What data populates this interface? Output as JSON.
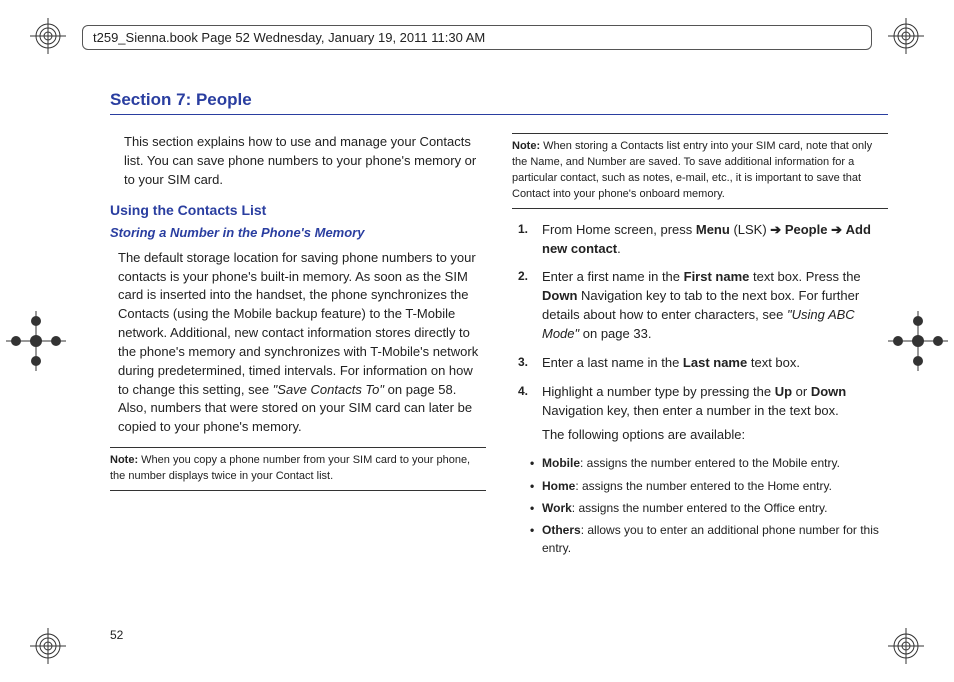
{
  "header": "t259_Sienna.book  Page 52  Wednesday, January 19, 2011  11:30 AM",
  "section_title": "Section 7: People",
  "page_num": "52",
  "left": {
    "intro": "This section explains how to use and manage your Contacts list. You can save phone numbers to your phone's memory or to your SIM card.",
    "h1": "Using the Contacts List",
    "h2": "Storing a Number in the Phone's Memory",
    "body": "The default storage location for saving phone numbers to your contacts is your phone's built-in memory. As soon as the SIM card is inserted into the handset, the phone synchronizes the Contacts (using the Mobile backup feature) to the T-Mobile network. Additional, new contact information stores directly to the phone's memory and synchronizes with T-Mobile's network during predetermined, timed intervals. For information on how to change this setting, see ",
    "body_ref": "\"Save Contacts To\"",
    "body_after": " on page 58. Also, numbers that were stored on your SIM card can later be copied to your phone's memory.",
    "note_lead": "Note:",
    "note": " When you copy a phone number from your SIM card to your phone, the number displays twice in your Contact list."
  },
  "right": {
    "note_lead": "Note:",
    "note": " When storing a Contacts list entry into your SIM card, note that only the Name, and Number are saved. To save additional information for a particular contact, such as notes, e-mail, etc., it is important to save that Contact into your phone's onboard memory.",
    "steps": [
      {
        "n": "1.",
        "pre": "From Home screen, press ",
        "b1": "Menu",
        "mid1": " (LSK) ",
        "arrow1": "➔",
        "sp1": " ",
        "b2": "People",
        "sp2": " ",
        "arrow2": "➔",
        "sp3": " ",
        "b3": "Add new contact",
        "post": "."
      },
      {
        "n": "2.",
        "pre": "Enter a first name in the ",
        "b1": "First name",
        "mid1": " text box. Press the ",
        "b2": "Down",
        "mid2": " Navigation key to tab to the next box. For further details about how to enter characters, see ",
        "i1": "\"Using ABC Mode\"",
        "post": " on page 33."
      },
      {
        "n": "3.",
        "pre": "Enter a last name in the ",
        "b1": "Last name",
        "post": " text box."
      },
      {
        "n": "4.",
        "pre": "Highlight a number type by pressing the ",
        "b1": "Up",
        "mid1": " or ",
        "b2": "Down",
        "post": " Navigation key, then enter a number in the text box.",
        "sub": "The following options are available:"
      }
    ],
    "bullets": [
      {
        "b": "Mobile",
        "t": ": assigns the number entered to the Mobile entry."
      },
      {
        "b": "Home",
        "t": ": assigns the number entered to the Home entry."
      },
      {
        "b": "Work",
        "t": ": assigns the number entered to the Office entry."
      },
      {
        "b": "Others",
        "t": ": allows you to enter an additional phone number for this entry."
      }
    ]
  }
}
